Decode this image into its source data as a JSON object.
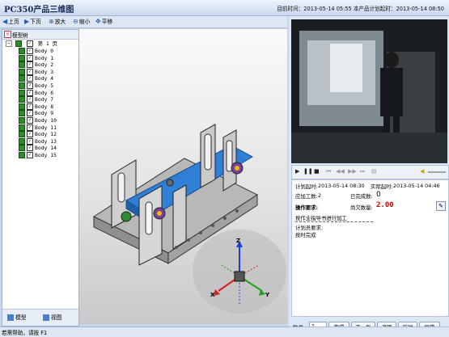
{
  "window": {
    "title": "PC350产品三维图",
    "clock": "目前时间：2013-05-14 05:55 本产品计划起时：2013-05-14 08:50"
  },
  "toolbar": [
    {
      "label": "上页",
      "icon": "arrow-left-icon"
    },
    {
      "label": "下页",
      "icon": "arrow-right-icon"
    },
    {
      "label": "放大",
      "icon": "zoom-in-icon"
    },
    {
      "label": "缩小",
      "icon": "zoom-out-icon"
    },
    {
      "label": "平移",
      "icon": "pan-icon"
    }
  ],
  "model_tree": {
    "panel_title": "模型树",
    "root": "第 1 页",
    "bodies": [
      "Body 0",
      "Body 1",
      "Body 2",
      "Body 3",
      "Body 4",
      "Body 5",
      "Body 6",
      "Body 7",
      "Body 8",
      "Body 9",
      "Body 10",
      "Body 11",
      "Body 12",
      "Body 13",
      "Body 14",
      "Body 15"
    ],
    "tabs": [
      "模型",
      "视图"
    ]
  },
  "triad": {
    "x": "X",
    "y": "Y",
    "z": "Z"
  },
  "media_controls": [
    "play-icon",
    "pause-icon",
    "stop-icon",
    "skip-back-icon",
    "rewind-icon",
    "forward-icon",
    "skip-forward-icon",
    "frame-icon",
    "volume-icon"
  ],
  "task": {
    "plan_start_label": "计划起时:",
    "plan_start_value": "2013-05-14 08:30",
    "actual_start_label": "实际起时:",
    "actual_start_value": "2013-05-14 04:46",
    "quota_label": "应加工数:",
    "quota_value": "2",
    "done_label": "已完成数:",
    "done_value": "0",
    "remaining_label": "尚欠数量:",
    "remaining_value": "2.00",
    "op_req_label": "操作要求:",
    "op_req_text": "按作业指导书进行加工",
    "plan_req_label": "计划员要求:",
    "plan_req_text": "按时完成"
  },
  "bottom": {
    "qty_label": "数量:",
    "qty_value": "1",
    "buttons": [
      "完成",
      "下一张",
      "返回",
      "延时",
      "异常"
    ]
  },
  "status": {
    "text": "若需帮助，请按 F1"
  }
}
